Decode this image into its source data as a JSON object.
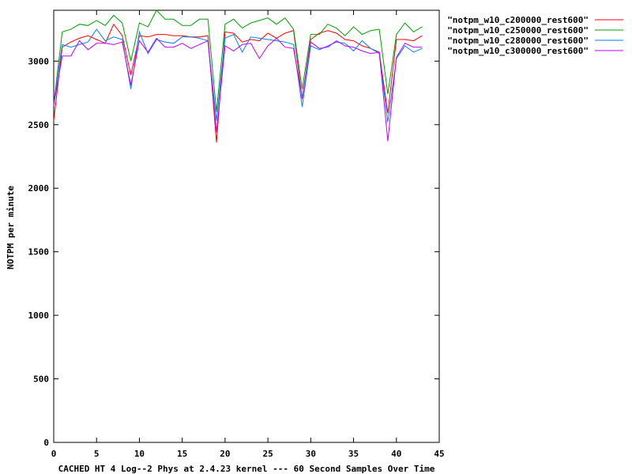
{
  "chart_data": {
    "type": "line",
    "title": "",
    "xlabel": "CACHED HT 4 Log--2 Phys at 2.4.23 kernel --- 60 Second Samples Over Time",
    "ylabel": "NOTPM per minute",
    "xlim": [
      0,
      45
    ],
    "ylim": [
      0,
      3400
    ],
    "xticks": [
      0,
      5,
      10,
      15,
      20,
      25,
      30,
      35,
      40,
      45
    ],
    "yticks": [
      0,
      500,
      1000,
      1500,
      2000,
      2500,
      3000
    ],
    "grid": false,
    "legend_position": "top-right outside",
    "x": [
      0,
      1,
      2,
      3,
      4,
      5,
      6,
      7,
      8,
      9,
      10,
      11,
      12,
      13,
      14,
      15,
      16,
      17,
      18,
      19,
      20,
      21,
      22,
      23,
      24,
      25,
      26,
      27,
      28,
      29,
      30,
      31,
      32,
      33,
      34,
      35,
      36,
      37,
      38,
      39,
      40,
      41,
      42,
      43
    ],
    "series": [
      {
        "name": "\"notpm_w10_c200000_rest600\"",
        "color": "#ff0000",
        "values": [
          2530,
          3110,
          3150,
          3180,
          3200,
          3170,
          3140,
          3290,
          3200,
          2890,
          3200,
          3190,
          3210,
          3210,
          3200,
          3200,
          3190,
          3190,
          3200,
          2360,
          3230,
          3220,
          3150,
          3170,
          3160,
          3220,
          3180,
          3220,
          3240,
          2700,
          3170,
          3220,
          3240,
          3220,
          3170,
          3160,
          3120,
          3100,
          3070,
          2590,
          3170,
          3170,
          3160,
          3200
        ]
      },
      {
        "name": "\"notpm_w10_c250000_rest600\"",
        "color": "#00a000",
        "values": [
          2660,
          3230,
          3250,
          3290,
          3280,
          3320,
          3280,
          3360,
          3300,
          3000,
          3300,
          3270,
          3400,
          3330,
          3330,
          3280,
          3280,
          3330,
          3330,
          2600,
          3290,
          3330,
          3260,
          3300,
          3320,
          3340,
          3290,
          3340,
          3250,
          2780,
          3210,
          3210,
          3290,
          3260,
          3200,
          3270,
          3210,
          3240,
          3250,
          2740,
          3210,
          3300,
          3230,
          3270
        ]
      },
      {
        "name": "\"notpm_w10_c280000_rest600\"",
        "color": "#0080ff",
        "values": [
          2660,
          3130,
          3110,
          3130,
          3150,
          3250,
          3160,
          3190,
          3170,
          2780,
          3230,
          3060,
          3170,
          3150,
          3140,
          3190,
          3190,
          3180,
          3160,
          2530,
          3180,
          3210,
          3070,
          3190,
          3180,
          3170,
          3160,
          3150,
          3130,
          2640,
          3120,
          3090,
          3120,
          3150,
          3140,
          3080,
          3160,
          3100,
          3060,
          2520,
          3020,
          3120,
          3070,
          3100
        ]
      },
      {
        "name": "\"notpm_w10_c300000_rest600\"",
        "color": "#c000ff",
        "values": [
          2650,
          3040,
          3040,
          3160,
          3090,
          3140,
          3140,
          3130,
          3150,
          2810,
          3160,
          3070,
          3180,
          3110,
          3110,
          3140,
          3100,
          3130,
          3160,
          2440,
          3120,
          3080,
          3130,
          3140,
          3020,
          3120,
          3180,
          3110,
          3100,
          2710,
          3150,
          3100,
          3110,
          3160,
          3120,
          3110,
          3080,
          3060,
          3070,
          2370,
          3030,
          3140,
          3110,
          3110
        ]
      }
    ]
  }
}
